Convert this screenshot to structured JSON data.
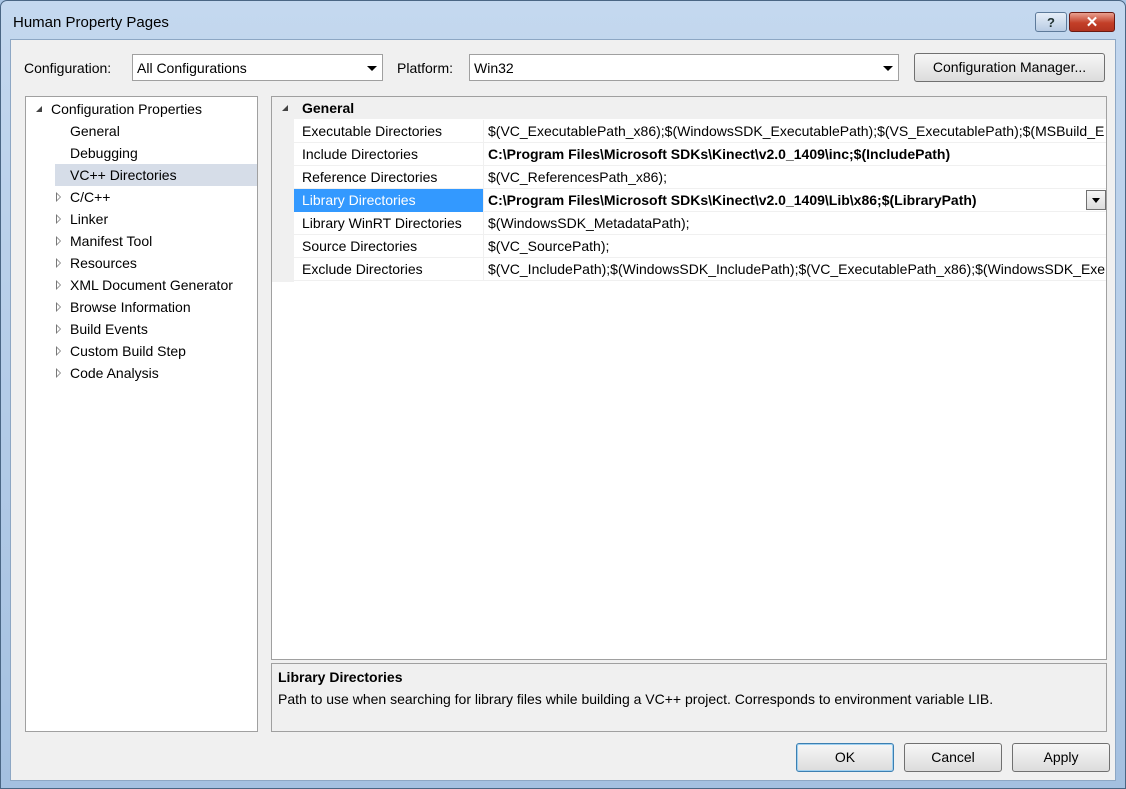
{
  "window": {
    "title": "Human Property Pages",
    "help_label": "?",
    "close_label": "✕"
  },
  "toolbar": {
    "configuration_label": "Configuration:",
    "configuration_value": "All Configurations",
    "platform_label": "Platform:",
    "platform_value": "Win32",
    "config_manager_label": "Configuration Manager..."
  },
  "tree": {
    "root": "Configuration Properties",
    "items": [
      {
        "label": "General",
        "expandable": false
      },
      {
        "label": "Debugging",
        "expandable": false
      },
      {
        "label": "VC++ Directories",
        "expandable": false,
        "selected": true
      },
      {
        "label": "C/C++",
        "expandable": true
      },
      {
        "label": "Linker",
        "expandable": true
      },
      {
        "label": "Manifest Tool",
        "expandable": true
      },
      {
        "label": "Resources",
        "expandable": true
      },
      {
        "label": "XML Document Generator",
        "expandable": true
      },
      {
        "label": "Browse Information",
        "expandable": true
      },
      {
        "label": "Build Events",
        "expandable": true
      },
      {
        "label": "Custom Build Step",
        "expandable": true
      },
      {
        "label": "Code Analysis",
        "expandable": true
      }
    ]
  },
  "grid": {
    "category": "General",
    "rows": [
      {
        "name": "Executable Directories",
        "value": "$(VC_ExecutablePath_x86);$(WindowsSDK_ExecutablePath);$(VS_ExecutablePath);$(MSBuild_E",
        "bold": false
      },
      {
        "name": "Include Directories",
        "value": "C:\\Program Files\\Microsoft SDKs\\Kinect\\v2.0_1409\\inc;$(IncludePath)",
        "bold": true
      },
      {
        "name": "Reference Directories",
        "value": "$(VC_ReferencesPath_x86);",
        "bold": false
      },
      {
        "name": "Library Directories",
        "value": "C:\\Program Files\\Microsoft SDKs\\Kinect\\v2.0_1409\\Lib\\x86;$(LibraryPath)",
        "bold": true,
        "selected": true
      },
      {
        "name": "Library WinRT Directories",
        "value": "$(WindowsSDK_MetadataPath);",
        "bold": false
      },
      {
        "name": "Source Directories",
        "value": "$(VC_SourcePath);",
        "bold": false
      },
      {
        "name": "Exclude Directories",
        "value": "$(VC_IncludePath);$(WindowsSDK_IncludePath);$(VC_ExecutablePath_x86);$(WindowsSDK_Exe",
        "bold": false
      }
    ]
  },
  "description": {
    "title": "Library Directories",
    "text": "Path to use when searching for library files while building a VC++ project.  Corresponds to environment variable LIB."
  },
  "buttons": {
    "ok": "OK",
    "cancel": "Cancel",
    "apply": "Apply"
  }
}
